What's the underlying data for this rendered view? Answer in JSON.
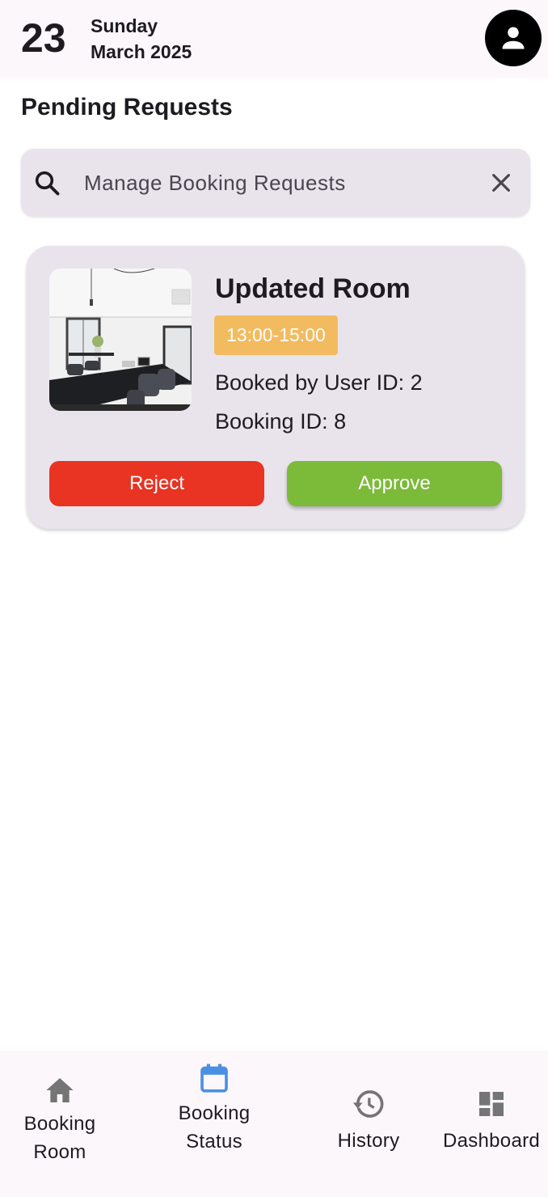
{
  "header": {
    "day_number": "23",
    "day_name": "Sunday",
    "month_year": "March 2025"
  },
  "page": {
    "title": "Pending Requests"
  },
  "search": {
    "placeholder": "Manage Booking Requests",
    "value": ""
  },
  "requests": [
    {
      "room_name": "Updated Room",
      "time_slot": "13:00-15:00",
      "booked_by": "Booked by User ID: 2",
      "booking_id": "Booking ID: 8",
      "reject_label": "Reject",
      "approve_label": "Approve"
    }
  ],
  "nav": {
    "items": [
      {
        "label_line1": "Booking",
        "label_line2": "Room",
        "icon": "home-icon",
        "active": false
      },
      {
        "label_line1": "Booking",
        "label_line2": "Status",
        "icon": "calendar-icon",
        "active": true
      },
      {
        "label_line1": "History",
        "icon": "history-icon",
        "active": false
      },
      {
        "label_line1": "Dashboard",
        "icon": "dashboard-icon",
        "active": false
      }
    ]
  },
  "colors": {
    "header_bg": "#fcf7fb",
    "surface": "#e9e4ec",
    "time_badge": "#f3bb5f",
    "reject": "#e93323",
    "approve": "#7cba3a",
    "nav_active": "#4a90e2",
    "nav_inactive": "#757575"
  }
}
